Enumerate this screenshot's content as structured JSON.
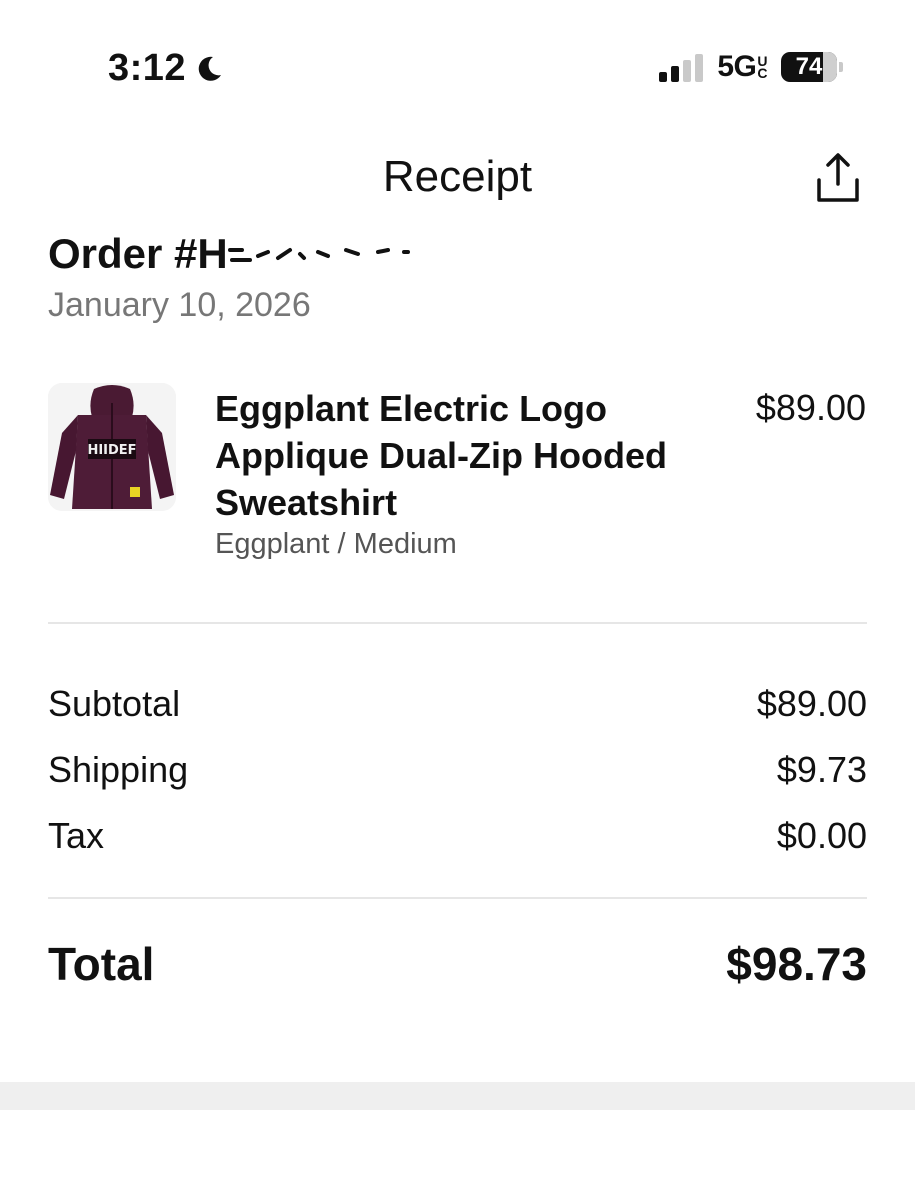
{
  "status_bar": {
    "time": "3:12",
    "network": "5G",
    "network_suffix_top": "U",
    "network_suffix_bottom": "C",
    "battery_level": "74",
    "signal_bars_active": 2,
    "signal_bars_total": 4
  },
  "header": {
    "title": "Receipt",
    "share_icon": "share-icon"
  },
  "order": {
    "number_prefix": "Order #H",
    "date": "January 10, 2026"
  },
  "item": {
    "name": "Eggplant Electric Logo Applique Dual-Zip Hooded Sweatshirt",
    "variant": "Eggplant / Medium",
    "price": "$89.00",
    "thumbnail_icon": "hoodie-image",
    "logo_text": "HIIDEF",
    "color": "#4a1a33"
  },
  "summary": {
    "rows": [
      {
        "label": "Subtotal",
        "value": "$89.00"
      },
      {
        "label": "Shipping",
        "value": "$9.73"
      },
      {
        "label": "Tax",
        "value": "$0.00"
      }
    ],
    "total_label": "Total",
    "total_value": "$98.73"
  }
}
